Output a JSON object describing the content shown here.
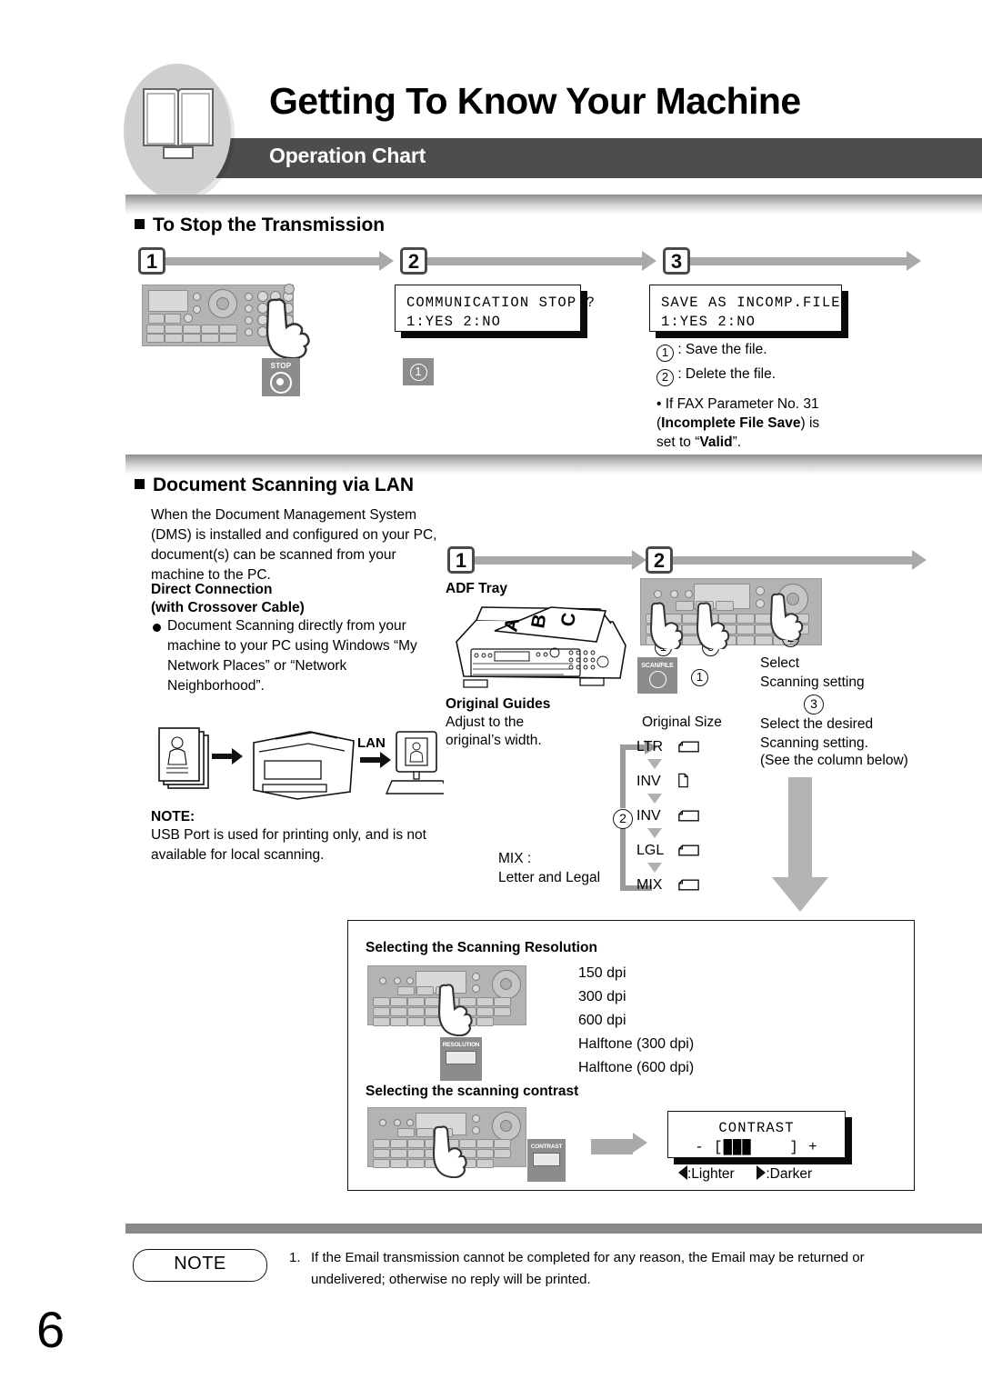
{
  "header": {
    "title": "Getting To Know Your Machine",
    "subtitle": "Operation Chart",
    "icon": "open-book-icon"
  },
  "sections": [
    {
      "id": "stop-transmission",
      "heading": "To Stop the Transmission",
      "steps": [
        "1",
        "2",
        "3"
      ],
      "step1": {
        "button_label": "STOP",
        "panel": "control-panel-illustration"
      },
      "step2": {
        "lcd_line1": "COMMUNICATION STOP ?",
        "lcd_line2": "1:YES 2:NO",
        "key_badge": "1"
      },
      "step3": {
        "lcd_line1": "SAVE AS INCOMP.FILE?",
        "lcd_line2": "1:YES 2:NO",
        "options": [
          {
            "num": "1",
            "text": ": Save the file."
          },
          {
            "num": "2",
            "text": ": Delete the file."
          }
        ],
        "bullet_pre": "• If FAX Parameter No. 31",
        "bullet_paren_open": "(",
        "bullet_bold1": "Incomplete File Save",
        "bullet_mid": ") is",
        "bullet_pre2": "set to “",
        "bullet_bold2": "Valid",
        "bullet_end": "”."
      }
    },
    {
      "id": "document-scanning-lan",
      "heading": "Document Scanning via LAN",
      "intro": "When the Document Management System (DMS) is installed and configured on your PC, document(s) can be scanned from your machine to the PC.",
      "direct_title_l1": "Direct Connection",
      "direct_title_l2": "(with Crossover Cable)",
      "direct_bullet": "Document Scanning directly from your machine to your PC using Windows “My Network Places” or “Network Neighborhood”.",
      "lan_label": "LAN",
      "note_title": "NOTE:",
      "note_body": "USB Port is used for printing only, and is not available for local scanning.",
      "steps": [
        "1",
        "2"
      ],
      "step1": {
        "title": "ADF Tray",
        "paper_letters": [
          "A",
          "B",
          "C"
        ],
        "guides_title": "Original Guides",
        "guides_body_l1": "Adjust to the",
        "guides_body_l2": "original’s width.",
        "mix_l1": "MIX :",
        "mix_l2": "Letter and Legal"
      },
      "step2": {
        "scan_file_key": "SCAN/FILE",
        "key_badges": [
          "1",
          "3",
          "2"
        ],
        "badge1": "1",
        "select_l1": "Select",
        "select_l2": "Scanning setting",
        "badge3": "3",
        "desired_l1": "Select the desired",
        "desired_l2": "Scanning setting.",
        "desired_l3": "(See the column below)"
      },
      "original_size": {
        "title": "Original Size",
        "loop_badge": "2",
        "items": [
          {
            "label": "LTR",
            "orient": "landscape"
          },
          {
            "label": "INV",
            "orient": "portrait"
          },
          {
            "label": "INV",
            "orient": "landscape"
          },
          {
            "label": "LGL",
            "orient": "landscape"
          },
          {
            "label": "MIX",
            "orient": "landscape"
          }
        ]
      },
      "scan_settings_box": {
        "resolution_title": "Selecting the Scanning Resolution",
        "resolution_key": "RESOLUTION",
        "resolutions": [
          "150 dpi",
          "300 dpi",
          "600 dpi",
          "Halftone (300 dpi)",
          "Halftone (600 dpi)"
        ],
        "contrast_title": "Selecting the scanning contrast",
        "contrast_key": "CONTRAST",
        "contrast_lcd_line1": "CONTRAST",
        "contrast_lcd_line2": "- [███    ] +",
        "contrast_legend_lighter": ":Lighter",
        "contrast_legend_darker": ":Darker"
      }
    }
  ],
  "footer": {
    "note_label": "NOTE",
    "note_item_num": "1.",
    "note_item_text": "If the Email transmission cannot be completed for any reason, the Email may be returned or undelivered; otherwise no reply will be printed.",
    "page_number": "6"
  },
  "colors": {
    "header_bar": "#4d4d4d",
    "arrow_gray": "#a9a9a9",
    "panel_gray": "#b3b3b3",
    "footer_bar": "#8a8a8a"
  }
}
